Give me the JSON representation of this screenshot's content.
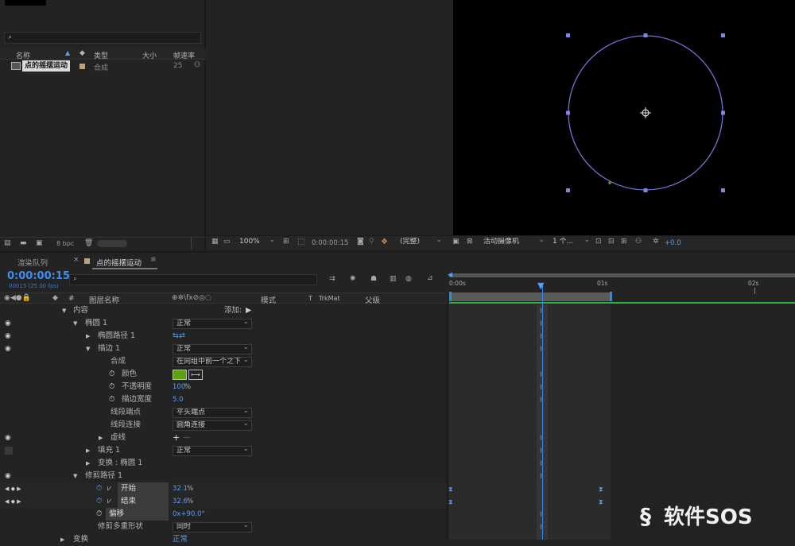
{
  "project": {
    "search_placeholder": "",
    "columns": [
      "名称",
      "类型",
      "大小",
      "帧速率"
    ],
    "item": {
      "name": "点的摇摆运动",
      "type": "合成",
      "fps": "25"
    },
    "bpc": "8 bpc"
  },
  "viewer": {
    "zoom": "100%",
    "timecode": "0:00:00:15",
    "quality": "(完整)",
    "camera": "活动摄像机",
    "views": "1 个...",
    "exposure": "+0.0"
  },
  "tabs": {
    "render_queue": "渲染队列",
    "comp": "点的摇摆运动"
  },
  "timeline": {
    "timecode": "0:00:00:15",
    "frame_info": "00015 (25.00 fps)",
    "col_layer_name": "图层名称",
    "col_mode": "模式",
    "col_t": "T",
    "col_trkmat": "TrkMat",
    "col_parent": "父级",
    "col_hash": "#",
    "ruler": [
      "0:00s",
      "01s",
      "02s"
    ]
  },
  "layers": {
    "contents": "内容",
    "add": "添加:",
    "ellipse": "椭圆 1",
    "ellipse_mode": "正常",
    "ellipse_path": "椭圆路径 1",
    "stroke": "描边 1",
    "stroke_mode": "正常",
    "composite": "合成",
    "composite_val": "在同组中前一个之下",
    "color": "颜色",
    "opacity": "不透明度",
    "opacity_val": "100",
    "opacity_unit": "%",
    "stroke_width": "描边宽度",
    "stroke_width_val": "5.0",
    "line_cap": "线段端点",
    "line_cap_val": "平头端点",
    "line_join": "线段连接",
    "line_join_val": "圆角连接",
    "dashes": "虚线",
    "fill": "填充 1",
    "fill_mode": "正常",
    "transform": "变换 : 椭圆 1",
    "trim": "修剪路径 1",
    "start": "开始",
    "start_val": "32.1",
    "start_unit": "%",
    "end": "结束",
    "end_val": "32.6",
    "end_unit": "%",
    "offset": "偏移",
    "offset_val": "0x+90.0°",
    "trim_multi": "修剪多重形状",
    "trim_multi_val": "同时",
    "bottom_partial": "变换",
    "bottom_partial_val": "正常"
  },
  "colors": {
    "stroke_color": "#5ea010",
    "circle": "#6f74d8",
    "accent": "#2d8ceb",
    "work_area_green": "#2db33a"
  },
  "watermark": "软件SOS"
}
